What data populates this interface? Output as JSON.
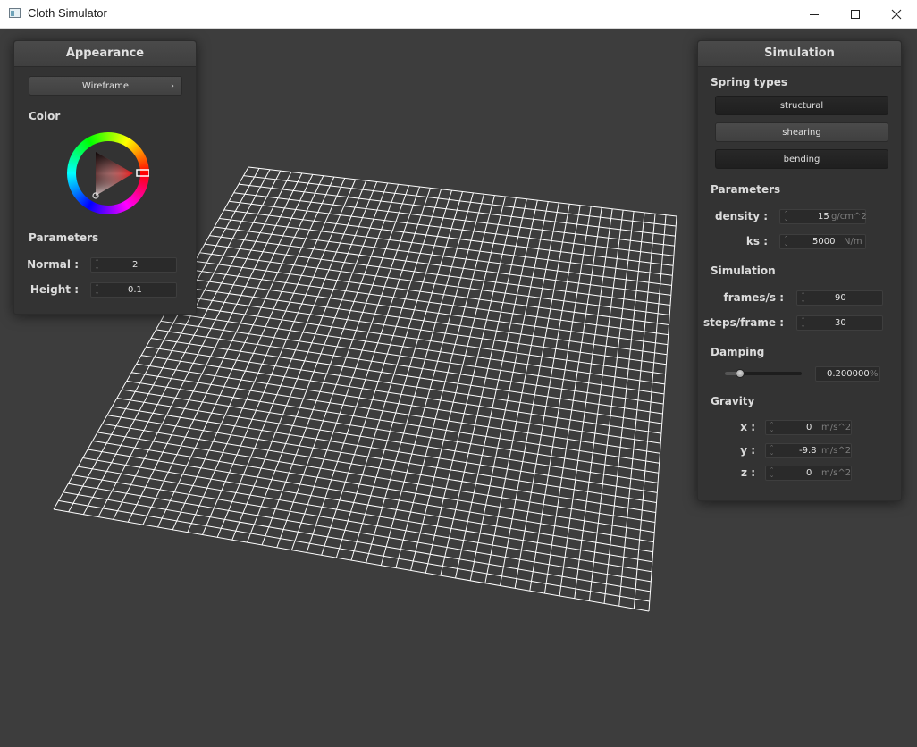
{
  "window": {
    "title": "Cloth Simulator"
  },
  "appearance": {
    "title": "Appearance",
    "render_mode": "Wireframe",
    "color_label": "Color",
    "color": "#e0201e",
    "parameters_label": "Parameters",
    "normal": {
      "label": "Normal :",
      "value": "2"
    },
    "height": {
      "label": "Height :",
      "value": "0.1"
    }
  },
  "simulation": {
    "title": "Simulation",
    "spring_types_label": "Spring types",
    "spring_types": [
      "structural",
      "shearing",
      "bending"
    ],
    "parameters_label": "Parameters",
    "density": {
      "label": "density :",
      "value": "15",
      "unit": "g/cm^2"
    },
    "ks": {
      "label": "ks :",
      "value": "5000",
      "unit": "N/m"
    },
    "simulation_label": "Simulation",
    "frames_per_s": {
      "label": "frames/s :",
      "value": "90"
    },
    "steps_per_frame": {
      "label": "steps/frame :",
      "value": "30"
    },
    "damping_label": "Damping",
    "damping": {
      "value": "0.200000",
      "unit": "%",
      "slider_level": 0.2
    },
    "gravity_label": "Gravity",
    "gravity": {
      "x": {
        "label": "x :",
        "value": "0",
        "unit": "m/s^2"
      },
      "y": {
        "label": "y :",
        "value": "-9.8",
        "unit": "m/s^2"
      },
      "z": {
        "label": "z :",
        "value": "0",
        "unit": "m/s^2"
      }
    }
  },
  "cloth": {
    "grid_divisions": 40,
    "line_color": "#ffffff"
  },
  "colors": {
    "background": "#3d3d3d",
    "panel": "#333333"
  }
}
